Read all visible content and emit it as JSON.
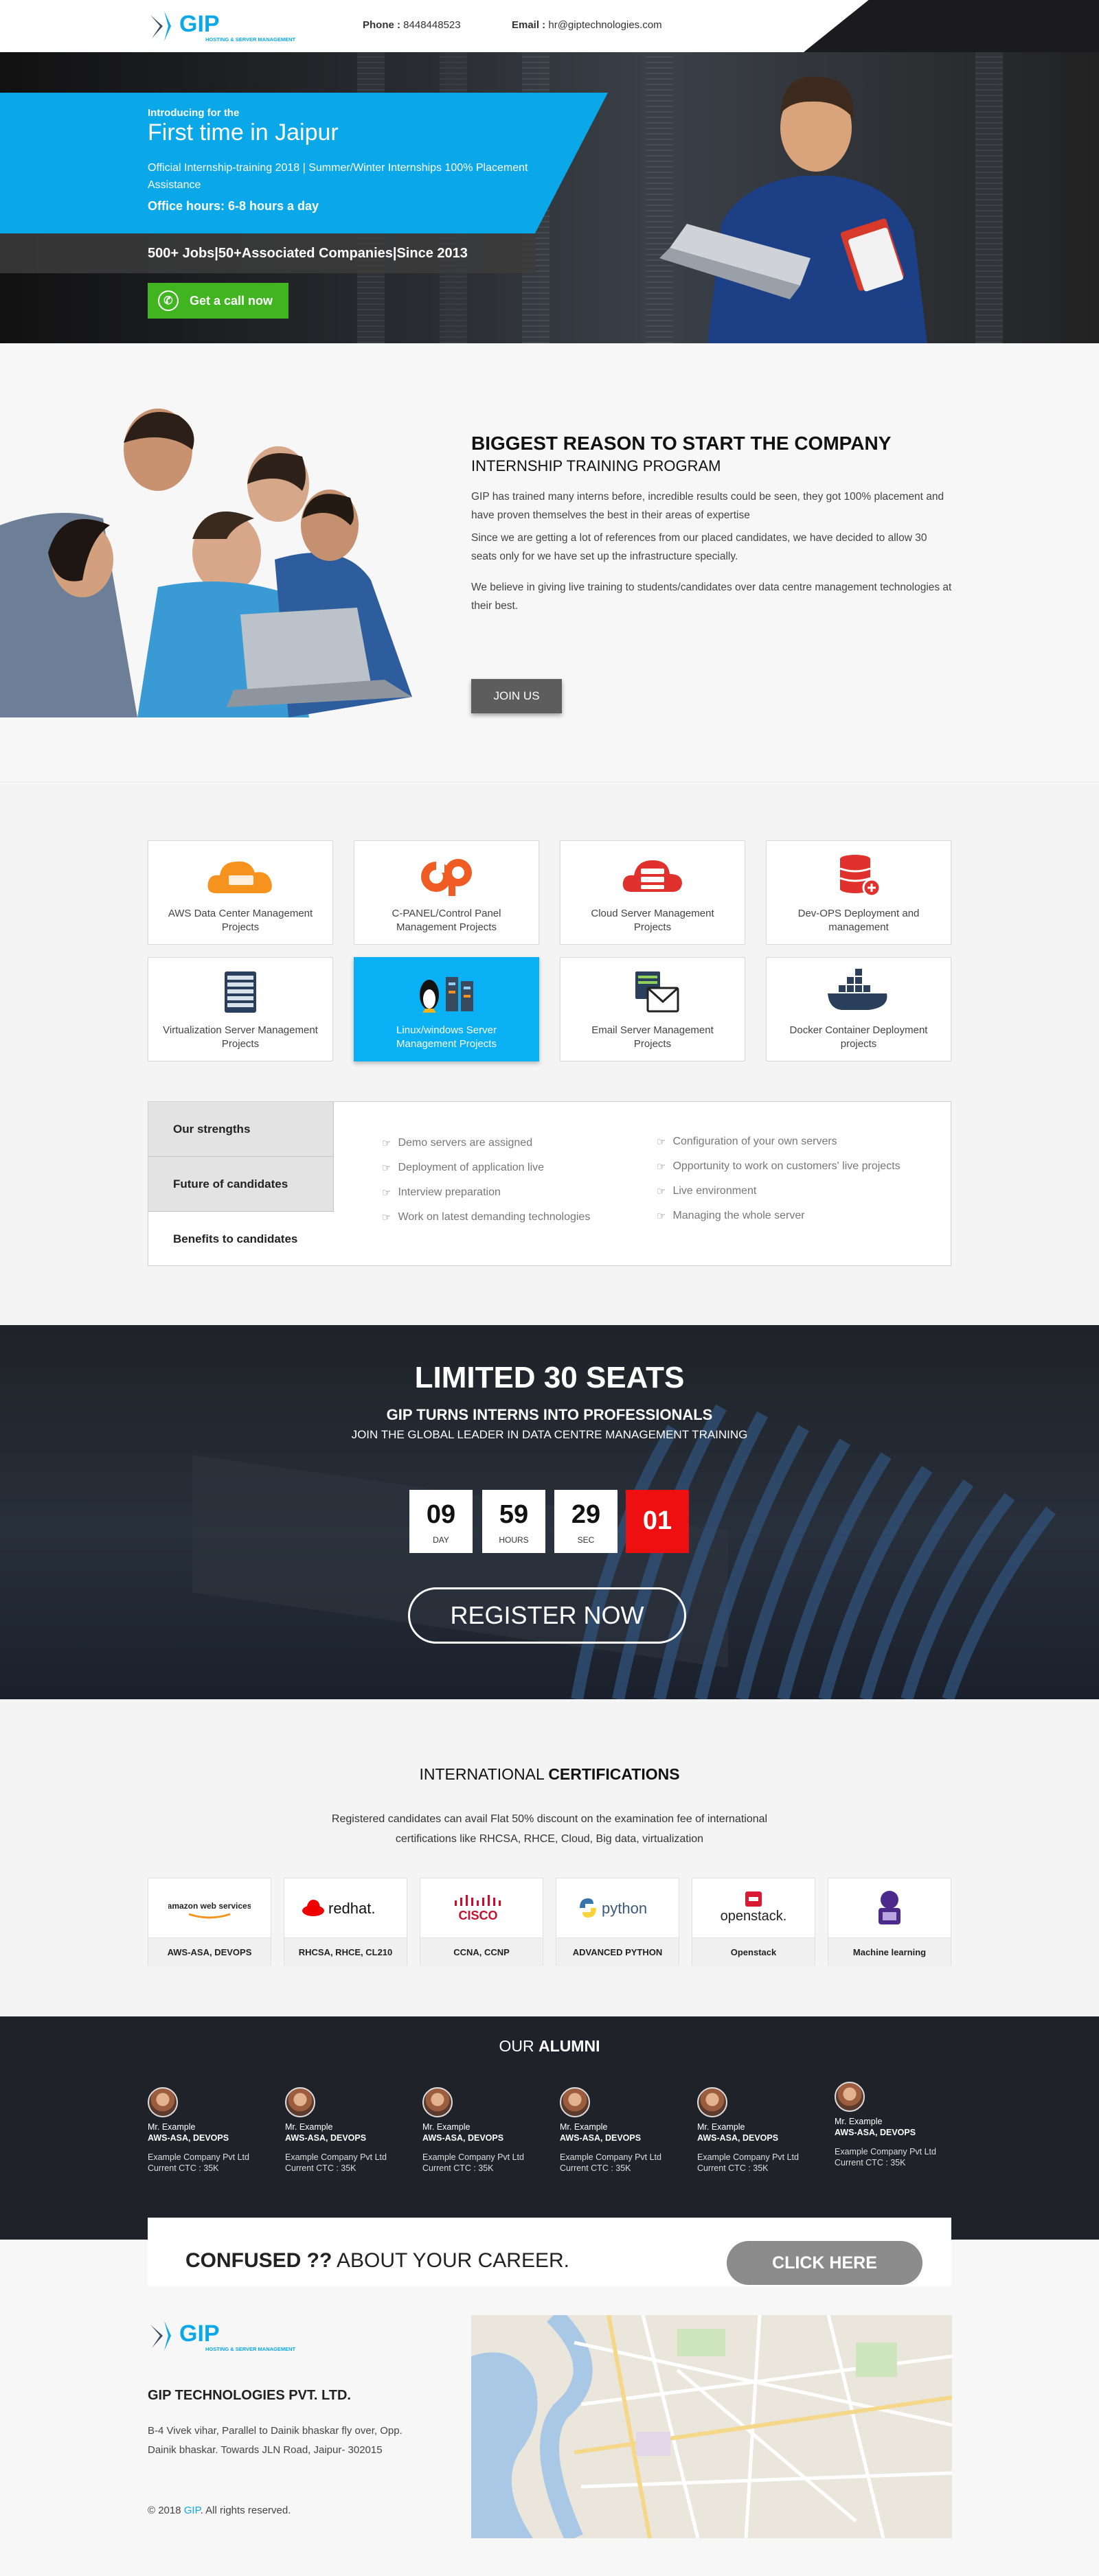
{
  "header": {
    "logo_text": "GIP",
    "logo_tagline": "HOSTING & SERVER MANAGEMENT",
    "phone_label": "Phone :",
    "phone_value": "8448448523",
    "email_label": "Email :",
    "email_value": "hr@giptechnologies.com"
  },
  "hero": {
    "intro": "Introducing for the",
    "title": "First time in Jaipur",
    "subtitle": "Official Internship-training 2018 | Summer/Winter Internships 100% Placement Assistance",
    "hours": "Office hours: 6-8 hours a day",
    "stats": "500+ Jobs|50+Associated Companies|Since 2013",
    "call_button": "Get a call now"
  },
  "reason": {
    "heading": "BIGGEST REASON TO START THE COMPANY",
    "subheading": "INTERNSHIP TRAINING PROGRAM",
    "p1": "GIP has trained many interns before, incredible results could be seen, they got 100% placement and have proven themselves the best in their areas of expertise",
    "p2": "Since we are getting a lot of references from our placed candidates, we have decided to allow 30 seats only for we have set up the infrastructure specially.",
    "p3": "We believe in giving live training to students/candidates over data centre management technologies at their best.",
    "join_button": "JOIN US"
  },
  "services": [
    {
      "label": "AWS Data Center Management Projects",
      "icon": "aws-icon"
    },
    {
      "label": "C-PANEL/Control Panel Management Projects",
      "icon": "cpanel-icon"
    },
    {
      "label": "Cloud Server Management Projects",
      "icon": "cloud-server-icon"
    },
    {
      "label": "Dev-OPS Deployment and management",
      "icon": "devops-database-icon"
    },
    {
      "label": "Virtualization Server Management Projects",
      "icon": "server-rack-icon"
    },
    {
      "label": "Linux/windows Server Management Projects",
      "icon": "linux-server-icon"
    },
    {
      "label": "Email Server Management Projects",
      "icon": "email-server-icon"
    },
    {
      "label": "Docker Container Deployment projects",
      "icon": "docker-icon"
    }
  ],
  "tabs": {
    "items": [
      "Our strengths",
      "Future of candidates",
      "Benefits to candidates"
    ],
    "active": "Benefits to candidates",
    "col1": [
      "Demo servers are assigned",
      "Deployment of application live",
      "Interview preparation",
      "Work on latest demanding technologies"
    ],
    "col2": [
      "Configuration of your own servers",
      "Opportunity to work on customers' live projects",
      "Live environment",
      "Managing the whole server"
    ]
  },
  "limited": {
    "title": "LIMITED 30 SEATS",
    "subtitle": "GIP TURNS INTERNS INTO PROFESSIONALS",
    "subtitle2": "JOIN THE GLOBAL LEADER IN DATA CENTRE MANAGEMENT TRAINING",
    "countdown": [
      {
        "value": "09",
        "unit": "DAY"
      },
      {
        "value": "59",
        "unit": "HOURS"
      },
      {
        "value": "29",
        "unit": "SEC"
      },
      {
        "value": "01",
        "unit": ""
      }
    ],
    "register_button": "REGISTER NOW"
  },
  "certs": {
    "title_regular": "INTERNATIONAL ",
    "title_bold": "CERTIFICATIONS",
    "description": "Registered candidates can avail Flat 50% discount on the examination fee of international certifications like RHCSA, RHCE, Cloud, Big data, virtualization",
    "items": [
      {
        "logo": "amazon web services",
        "caption": "AWS-ASA, DEVOPS"
      },
      {
        "logo": "redhat.",
        "caption": "RHCSA, RHCE, CL210"
      },
      {
        "logo": "CISCO",
        "caption": "CCNA, CCNP"
      },
      {
        "logo": "python",
        "caption": "ADVANCED PYTHON"
      },
      {
        "logo": "openstack.",
        "caption": "Openstack"
      },
      {
        "logo": "",
        "caption": "Machine learning"
      }
    ]
  },
  "alumni": {
    "title_regular": "OUR ",
    "title_bold": "ALUMNI",
    "items": [
      {
        "name": "Mr. Example",
        "role": "AWS-ASA, DEVOPS",
        "company": "Example Company Pvt Ltd",
        "ctc": "Current CTC : 35K"
      },
      {
        "name": "Mr. Example",
        "role": "AWS-ASA, DEVOPS",
        "company": "Example Company Pvt Ltd",
        "ctc": "Current CTC : 35K"
      },
      {
        "name": "Mr. Example",
        "role": "AWS-ASA, DEVOPS",
        "company": "Example Company Pvt Ltd",
        "ctc": "Current CTC : 35K"
      },
      {
        "name": "Mr. Example",
        "role": "AWS-ASA, DEVOPS",
        "company": "Example Company Pvt Ltd",
        "ctc": "Current CTC : 35K"
      },
      {
        "name": "Mr. Example",
        "role": "AWS-ASA, DEVOPS",
        "company": "Example Company Pvt Ltd",
        "ctc": "Current CTC : 35K"
      },
      {
        "name": "Mr. Example",
        "role": "AWS-ASA, DEVOPS",
        "company": "Example Company Pvt Ltd",
        "ctc": "Current CTC : 35K"
      }
    ]
  },
  "confused": {
    "bold": "CONFUSED ??",
    "regular": " ABOUT YOUR CAREER.",
    "button": "CLICK HERE"
  },
  "footer": {
    "company": "GIP TECHNOLOGIES PVT. LTD.",
    "address": "B-4 Vivek vihar, Parallel to Dainik bhaskar fly over, Opp. Dainik bhaskar. Towards JLN Road, Jaipur- 302015",
    "copyright_prefix": "© 2018 ",
    "copyright_brand": "GIP",
    "copyright_suffix": ". All rights reserved."
  },
  "colors": {
    "accent_blue": "#0aa8e8",
    "call_green": "#41b51f",
    "countdown_red": "#ee1010",
    "dark_bg": "#1f2329"
  }
}
